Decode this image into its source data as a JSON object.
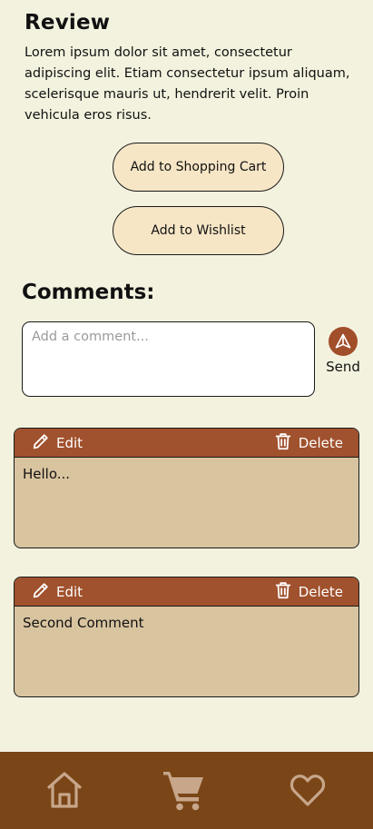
{
  "review": {
    "title": "Review",
    "text": "Lorem ipsum dolor sit amet, consectetur adipiscing elit. Etiam consectetur ipsum aliquam, scelerisque mauris ut, hendrerit velit. Proin vehicula eros risus."
  },
  "actions": {
    "cart_label": "Add to Shopping Cart",
    "wishlist_label": "Add to Wishlist"
  },
  "comments": {
    "title": "Comments:",
    "input_placeholder": "Add a comment...",
    "input_value": "",
    "send_label": "Send",
    "send_icon": "send-arrow-icon",
    "edit_label": "Edit",
    "edit_icon": "pencil-icon",
    "delete_label": "Delete",
    "delete_icon": "trash-icon",
    "items": [
      {
        "text": "Hello..."
      },
      {
        "text": "Second Comment"
      }
    ]
  },
  "nav": {
    "items": [
      {
        "icon": "home-icon"
      },
      {
        "icon": "cart-icon"
      },
      {
        "icon": "heart-icon"
      }
    ]
  },
  "colors": {
    "background": "#f3f2de",
    "button_fill": "#f7e6c6",
    "accent": "#a0512d",
    "card_body": "#d9c4a0",
    "nav_bar": "#7a4517",
    "nav_icon": "#c7a68a"
  }
}
